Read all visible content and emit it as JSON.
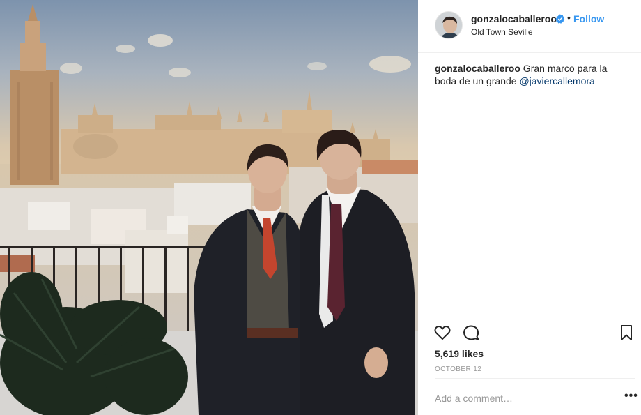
{
  "post": {
    "username": "gonzalocaballeroo",
    "dot": "•",
    "follow_label": "Follow",
    "location": "Old Town Seville",
    "caption_user": "gonzalocaballeroo",
    "caption_text": " Gran marco para la boda de un grande ",
    "caption_mention": "@javiercallemora",
    "likes": "5,619 likes",
    "date": "OCTOBER 12",
    "comment_placeholder": "Add a comment…",
    "more_label": "•••"
  },
  "colors": {
    "accent": "#3897f0",
    "mention": "#003569",
    "muted": "#999999",
    "text": "#262626",
    "divider": "#efefef"
  },
  "icons": [
    "verified-badge-icon",
    "heart-icon",
    "comment-icon",
    "bookmark-icon",
    "more-options-icon"
  ]
}
